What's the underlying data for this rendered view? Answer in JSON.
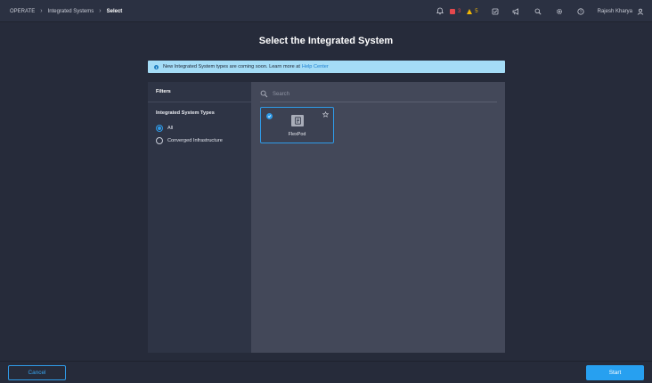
{
  "breadcrumb": {
    "items": [
      "OPERATE",
      "Integrated Systems"
    ],
    "current": "Select"
  },
  "topbar": {
    "alarms_critical": "3",
    "alarms_warning": "5",
    "user_name": "Rajesh Kharya",
    "icons": [
      "bell-icon",
      "critical-alarm-icon",
      "warning-alarm-icon",
      "tasks-icon",
      "announcement-icon",
      "search-icon",
      "gear-icon",
      "help-icon",
      "user-icon"
    ]
  },
  "page": {
    "title": "Select the Integrated System"
  },
  "info_banner": {
    "text": "New Integrated System types are coming soon. Learn more at",
    "link_text": "Help Center"
  },
  "filters": {
    "title": "Filters",
    "group_title": "Integrated System Types",
    "options": [
      {
        "label": "All",
        "selected": true
      },
      {
        "label": "Converged Infrastructure",
        "selected": false
      }
    ]
  },
  "search": {
    "placeholder": "Search"
  },
  "cards": [
    {
      "label": "FlexPod",
      "selected": true
    }
  ],
  "footer": {
    "cancel_label": "Cancel",
    "start_label": "Start"
  },
  "colors": {
    "accent": "#2f9be8",
    "critical": "#e5484d",
    "warning": "#f2b705",
    "banner": "#a4dcf6"
  }
}
